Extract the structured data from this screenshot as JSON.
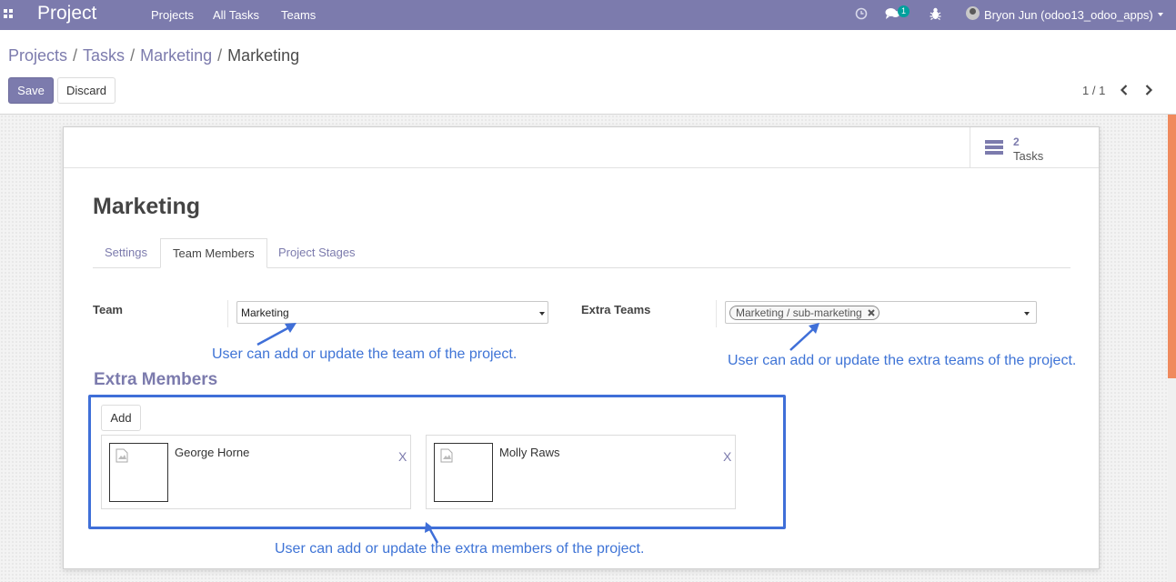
{
  "navbar": {
    "app_title": "Project",
    "menus": [
      "Projects",
      "All Tasks",
      "Teams"
    ],
    "chat_count": "1",
    "user": "Bryon Jun (odoo13_odoo_apps)"
  },
  "breadcrumb": {
    "items": [
      "Projects",
      "Tasks",
      "Marketing"
    ],
    "separator": "/",
    "current": "Marketing"
  },
  "buttons": {
    "save": "Save",
    "discard": "Discard",
    "add": "Add"
  },
  "pager": {
    "value": "1 / 1"
  },
  "smart_button": {
    "value": "2",
    "label": "Tasks"
  },
  "record": {
    "title": "Marketing"
  },
  "tabs": [
    "Settings",
    "Team Members",
    "Project Stages"
  ],
  "active_tab": "Team Members",
  "fields": {
    "team": {
      "label": "Team",
      "value": "Marketing"
    },
    "extra_teams": {
      "label": "Extra Teams",
      "tags": [
        "Marketing / sub-marketing"
      ]
    }
  },
  "extra_members": {
    "title": "Extra Members",
    "members": [
      {
        "name": "George Horne",
        "remove": "X"
      },
      {
        "name": "Molly Raws",
        "remove": "X"
      }
    ]
  },
  "annotations": {
    "team": "User can add or update the team of the project.",
    "extra_teams": "User can add or update the extra teams of the project.",
    "members": "User can add or update the extra members of the project."
  },
  "colors": {
    "brand": "#7c7bad",
    "annotation": "#3f74d6",
    "highlight_border": "#3f6fd8",
    "chat_badge": "#00a09d",
    "scrollbar_thumb": "#f08a5d"
  },
  "icons": [
    "apps-grid-icon",
    "clock-icon",
    "chat-icon",
    "bug-icon",
    "tasks-list-icon",
    "image-placeholder-icon",
    "chevron-left-icon",
    "chevron-right-icon"
  ]
}
